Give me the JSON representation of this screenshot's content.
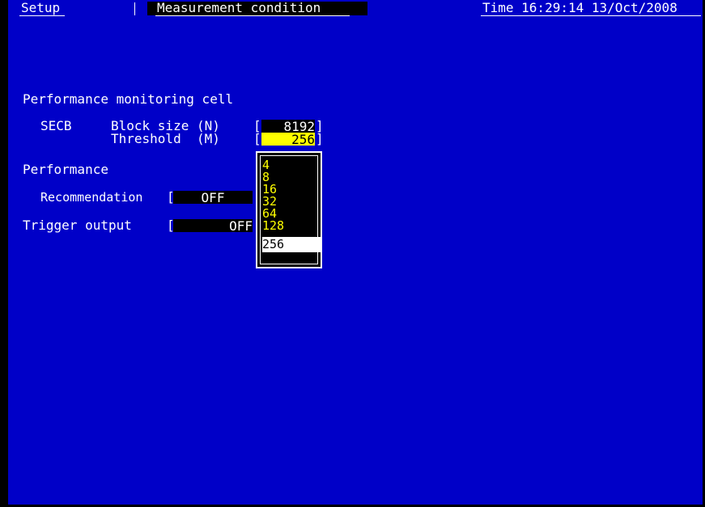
{
  "header": {
    "screen": "Setup",
    "page_title": "Measurement condition",
    "time": "Time 16:29:14 13/Oct/2008"
  },
  "pm_cell": {
    "heading": "Performance monitoring cell",
    "secb_label": "SECB",
    "block_size_label": "Block size (N)",
    "block_size_value": "8192",
    "threshold_label": "Threshold  (M)",
    "threshold_value": "256",
    "bracket_open": "[",
    "bracket_close": "]"
  },
  "performance": {
    "heading": "Performance",
    "recommendation_label": "Recommendation",
    "recommendation_value": "OFF",
    "bracket_open": "["
  },
  "trigger": {
    "label": "Trigger output",
    "value": "OFF",
    "bracket_open": "["
  },
  "dropdown": {
    "options": [
      "4",
      "8",
      "16",
      "32",
      "64",
      "128",
      "256"
    ],
    "selected": "256"
  },
  "colors": {
    "background": "#0000c8",
    "highlight": "#ffff00",
    "text": "#ffffff"
  }
}
